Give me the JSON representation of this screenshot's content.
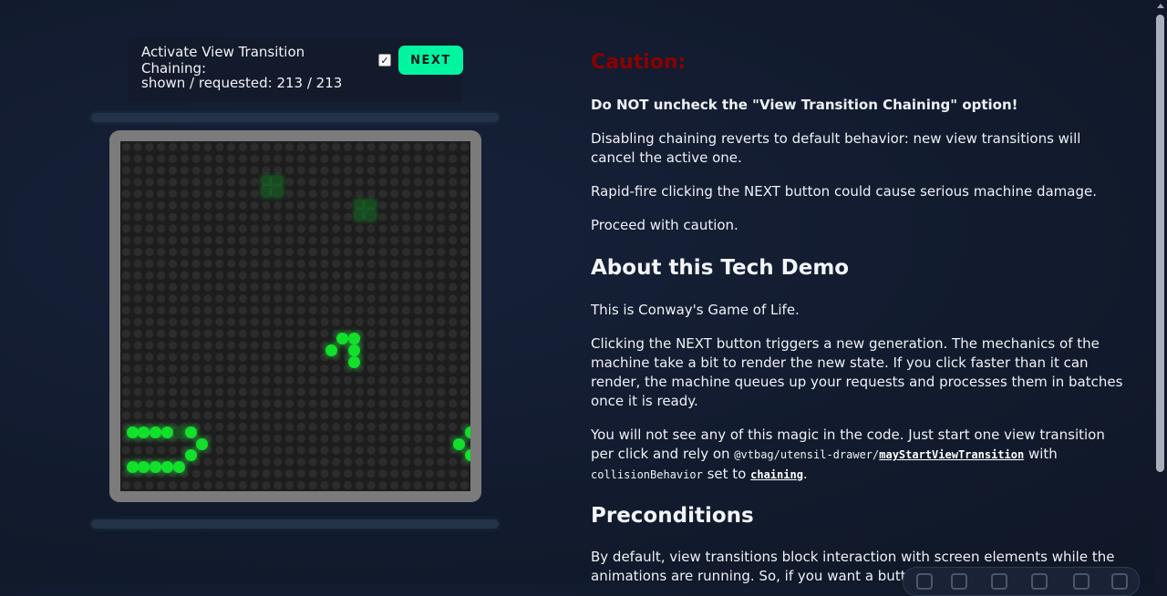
{
  "controls": {
    "chaining_label": "Activate View Transition Chaining:",
    "chaining_checked": true,
    "checkmark_glyph": "✓",
    "next_label": "NEXT",
    "status_text": "shown / requested: 213 / 213",
    "next_color": "#00f5a0"
  },
  "board": {
    "cell_icon": "led-dot",
    "live_color": "#12e02b",
    "fading_color": "#1a4a21",
    "background": "#1d1d1d",
    "frame_color": "#7b7b7b"
  },
  "article": {
    "caution_title": "Caution:",
    "caution_color": "#8b0000",
    "warning": "Do NOT uncheck the \"View Transition Chaining\" option!",
    "p1": "Disabling chaining reverts to default behavior: new view transitions will cancel the active one.",
    "p2": "Rapid-fire clicking the NEXT button could cause serious machine damage.",
    "p3": "Proceed with caution.",
    "about_heading": "About this Tech Demo",
    "p4": "This is Conway's Game of Life.",
    "p5": "Clicking the NEXT button triggers a new generation. The mechanics of the machine take a bit to render the new state. If you click faster than it can render, the machine queues up your requests and processes them in batches once it is ready.",
    "p6_text1": "You will not see any of this magic in the code. Just start one view transition per click and rely on ",
    "p6_code1": "@vtbag/utensil-drawer/",
    "p6_link1": "mayStartViewTransition",
    "p6_text2": " with ",
    "p6_code2": "collisionBehavior",
    "p6_text3": " set to ",
    "p6_link2": "chaining",
    "p6_text4": ".",
    "preconditions_heading": "Preconditions",
    "p7": "By default, view transitions block interaction with screen elements while the animations are running. So, if you want a button"
  }
}
